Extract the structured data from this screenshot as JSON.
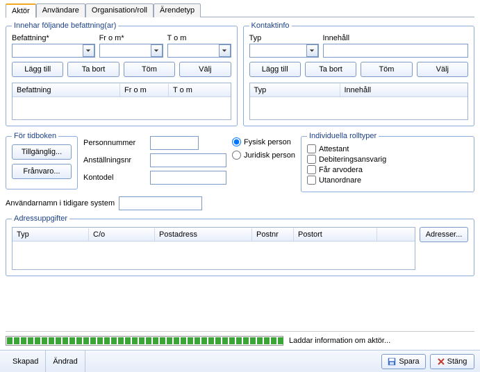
{
  "tabs": {
    "aktor": "Aktör",
    "anvandare": "Användare",
    "orgroll": "Organisation/roll",
    "arendetyp": "Ärendetyp"
  },
  "befattningar": {
    "legend": "Innehar följande befattning(ar)",
    "labels": {
      "befattning": "Befattning*",
      "from": "Fr o m*",
      "tom": "T o m"
    },
    "buttons": {
      "lagg": "Lägg till",
      "tabort": "Ta bort",
      "tom": "Töm",
      "valj": "Välj"
    },
    "headers": {
      "befattning": "Befattning",
      "from": "Fr o m",
      "tom": "T o m"
    }
  },
  "kontaktinfo": {
    "legend": "Kontaktinfo",
    "labels": {
      "typ": "Typ",
      "innehall": "Innehåll"
    },
    "buttons": {
      "lagg": "Lägg till",
      "tabort": "Ta bort",
      "tom": "Töm",
      "valj": "Välj"
    },
    "headers": {
      "typ": "Typ",
      "innehall": "Innehåll"
    }
  },
  "tidboken": {
    "legend": "För tidboken",
    "buttons": {
      "tillg": "Tillgänglig...",
      "franvaro": "Frånvaro..."
    }
  },
  "person": {
    "labels": {
      "personnr": "Personnummer",
      "anstnr": "Anställningsnr",
      "kontodel": "Kontodel"
    },
    "values": {
      "personnr": "",
      "anstnr": "",
      "kontodel": ""
    }
  },
  "persontype": {
    "fysisk": "Fysisk person",
    "juridisk": "Juridisk person"
  },
  "rolltyper": {
    "legend": "Individuella rolltyper",
    "items": {
      "attestant": "Attestant",
      "debit": "Debiteringsansvarig",
      "arvodera": "Får arvodera",
      "utan": "Utanordnare"
    }
  },
  "userline": {
    "label": "Användarnamn i tidigare system",
    "value": ""
  },
  "adress": {
    "legend": "Adressuppgifter",
    "headers": {
      "typ": "Typ",
      "co": "C/o",
      "postadress": "Postadress",
      "postnr": "Postnr",
      "postort": "Postort"
    },
    "button": "Adresser..."
  },
  "progress": {
    "text": "Laddar information om aktör..."
  },
  "bottom": {
    "skapad": "Skapad",
    "andrad": "Ändrad",
    "spara": "Spara",
    "stang": "Stäng"
  }
}
